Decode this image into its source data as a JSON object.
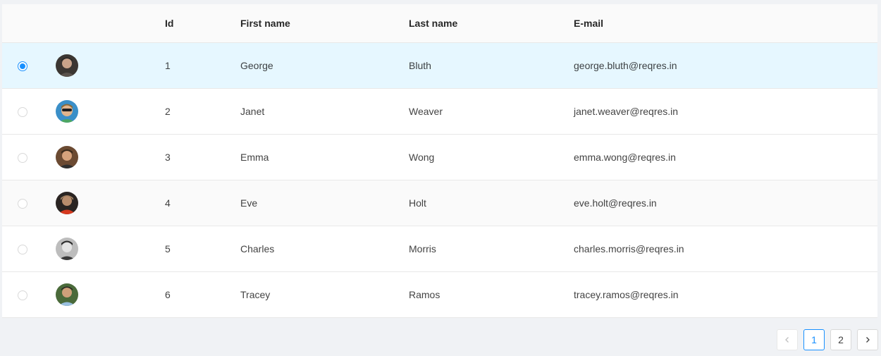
{
  "table": {
    "headers": {
      "id": "Id",
      "first_name": "First name",
      "last_name": "Last name",
      "email": "E-mail"
    },
    "rows": [
      {
        "id": "1",
        "first_name": "George",
        "last_name": "Bluth",
        "email": "george.bluth@reqres.in",
        "selected": true,
        "avatar_icon": "george-avatar"
      },
      {
        "id": "2",
        "first_name": "Janet",
        "last_name": "Weaver",
        "email": "janet.weaver@reqres.in",
        "selected": false,
        "avatar_icon": "janet-avatar"
      },
      {
        "id": "3",
        "first_name": "Emma",
        "last_name": "Wong",
        "email": "emma.wong@reqres.in",
        "selected": false,
        "avatar_icon": "emma-avatar"
      },
      {
        "id": "4",
        "first_name": "Eve",
        "last_name": "Holt",
        "email": "eve.holt@reqres.in",
        "selected": false,
        "avatar_icon": "eve-avatar"
      },
      {
        "id": "5",
        "first_name": "Charles",
        "last_name": "Morris",
        "email": "charles.morris@reqres.in",
        "selected": false,
        "avatar_icon": "charles-avatar"
      },
      {
        "id": "6",
        "first_name": "Tracey",
        "last_name": "Ramos",
        "email": "tracey.ramos@reqres.in",
        "selected": false,
        "avatar_icon": "tracey-avatar"
      }
    ]
  },
  "pagination": {
    "prev_icon": "chevron-left-icon",
    "pages": [
      "1",
      "2"
    ],
    "current_page": "1",
    "next_icon": "chevron-right-icon"
  },
  "colors": {
    "accent": "#1890ff",
    "selected_row": "#e6f7ff",
    "header_bg": "#fafafa",
    "page_bg": "#f0f2f5"
  }
}
